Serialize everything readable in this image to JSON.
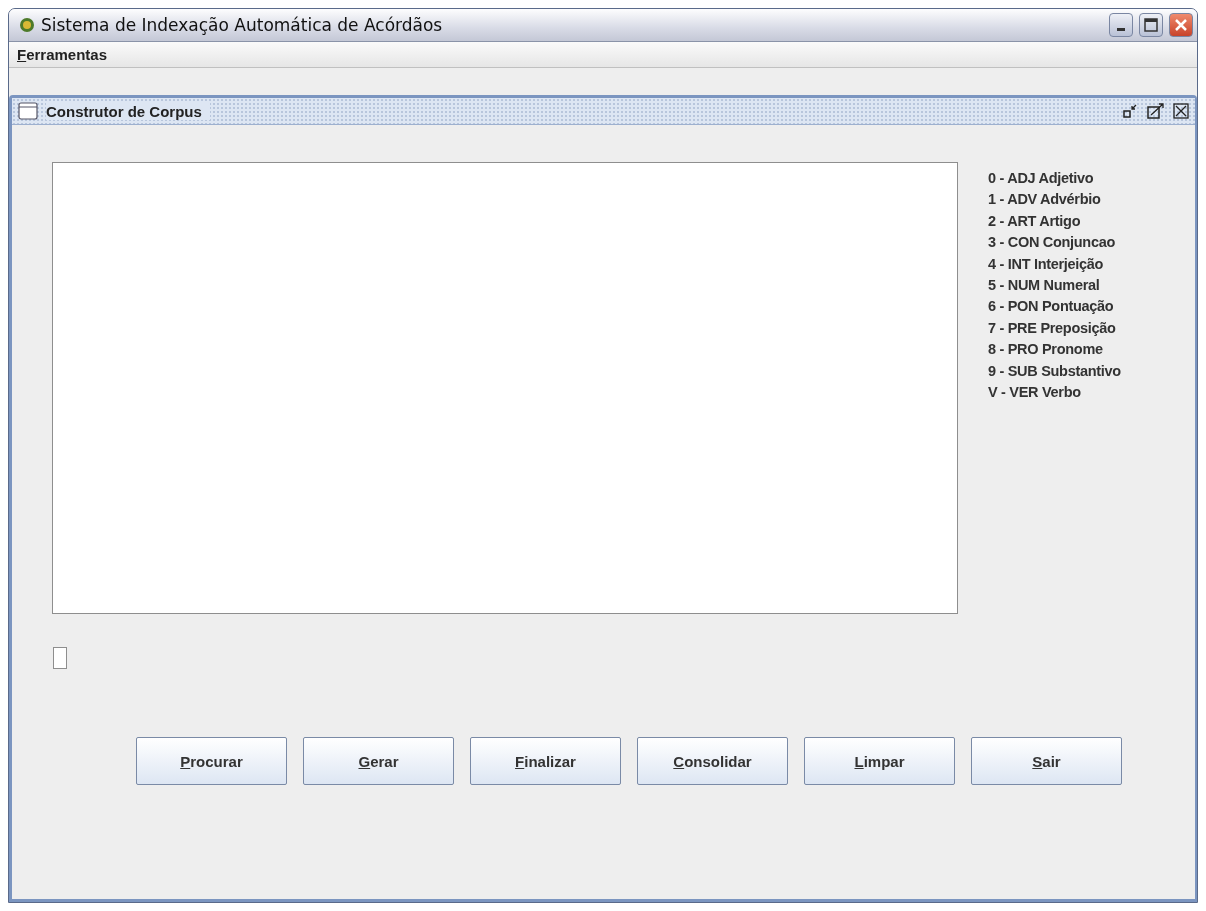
{
  "window": {
    "title": "Sistema de Indexação Automática de Acórdãos"
  },
  "menu": [
    "Ferramentas"
  ],
  "internal_frame": {
    "title": "Construtor de Corpus"
  },
  "legend": [
    "0 - ADJ Adjetivo",
    "1 - ADV Advérbio",
    "2 - ART Artigo",
    "3 - CON Conjuncao",
    "4 - INT Interjeição",
    "5 - NUM Numeral",
    "6 - PON Pontuação",
    "7 - PRE Preposição",
    "8 - PRO Pronome",
    "9 - SUB Substantivo",
    "V - VER Verbo"
  ],
  "buttons": [
    "Procurar",
    "Gerar",
    "Finalizar",
    "Consolidar",
    "Limpar",
    "Sair"
  ]
}
